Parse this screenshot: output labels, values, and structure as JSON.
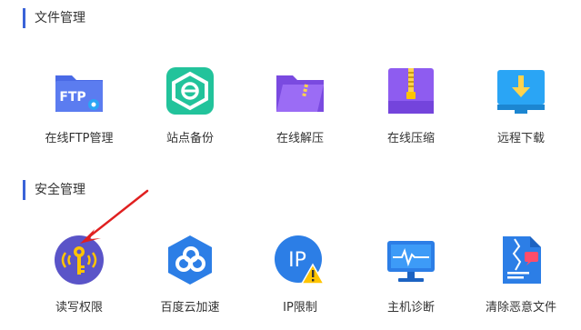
{
  "sections": [
    {
      "title": "文件管理",
      "tools": [
        {
          "label": "在线FTP管理",
          "icon": "ftp-folder-icon",
          "badge": "FTP"
        },
        {
          "label": "站点备份",
          "icon": "site-backup-icon"
        },
        {
          "label": "在线解压",
          "icon": "unzip-folder-icon"
        },
        {
          "label": "在线压缩",
          "icon": "zip-archive-icon"
        },
        {
          "label": "远程下载",
          "icon": "remote-download-icon"
        }
      ]
    },
    {
      "title": "安全管理",
      "tools": [
        {
          "label": "读写权限",
          "icon": "read-write-permission-icon"
        },
        {
          "label": "百度云加速",
          "icon": "baidu-cloud-accelerate-icon"
        },
        {
          "label": "IP限制",
          "icon": "ip-restriction-icon",
          "badge": "IP"
        },
        {
          "label": "主机诊断",
          "icon": "host-diagnosis-icon"
        },
        {
          "label": "清除恶意文件",
          "icon": "clean-malicious-file-icon"
        }
      ]
    }
  ],
  "colors": {
    "accent": "#3a63d8",
    "ftp_folder": "#5b7cf0",
    "backup_green": "#22c39b",
    "purple": "#8e5cf0",
    "download_blue": "#2aa5f5",
    "arrow_red": "#e02020",
    "warning_yellow": "#ffc400"
  },
  "annotation": {
    "type": "arrow",
    "points_to": "读写权限"
  }
}
